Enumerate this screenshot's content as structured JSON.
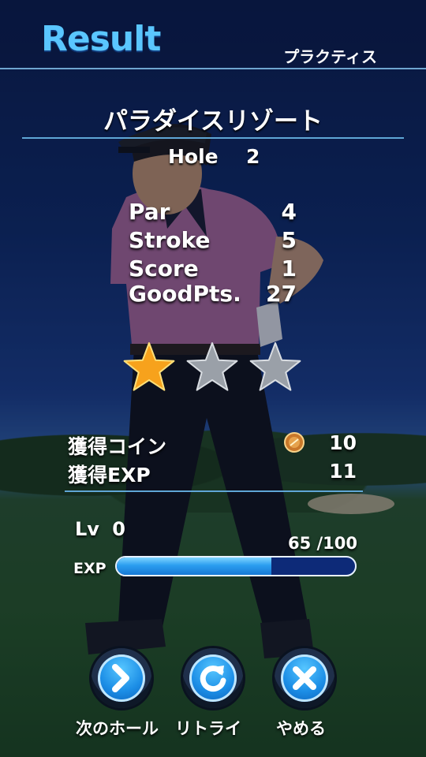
{
  "header": {
    "title": "Result",
    "mode": "プラクティス"
  },
  "course": {
    "name": "パラダイスリゾート",
    "hole_label": "Hole",
    "hole_number": "2"
  },
  "stats": [
    {
      "label": "Par",
      "value": "4"
    },
    {
      "label": "Stroke",
      "value": "5"
    },
    {
      "label": "Score",
      "value": "1"
    },
    {
      "label": "GoodPts.",
      "value": "27"
    }
  ],
  "stars": {
    "earned": 1,
    "total": 3,
    "colors": {
      "earned": "#f7a21c",
      "empty": "#9aa0a8"
    }
  },
  "gains": {
    "coin_label": "獲得コイン",
    "coin_value": "10",
    "coin_icon": "coin-icon",
    "exp_label": "獲得EXP",
    "exp_value": "11"
  },
  "level": {
    "label": "Lv",
    "value": "0",
    "exp_label": "EXP",
    "exp_count": "65 /100",
    "exp_fraction": 0.65
  },
  "buttons": [
    {
      "label": "次のホール",
      "icon": "next-arrow-icon"
    },
    {
      "label": "リトライ",
      "icon": "retry-icon"
    },
    {
      "label": "やめる",
      "icon": "close-icon"
    }
  ],
  "colors": {
    "accent": "#5ac6ff",
    "divider": "#5fa6d6",
    "button": "#1c8ee6"
  }
}
